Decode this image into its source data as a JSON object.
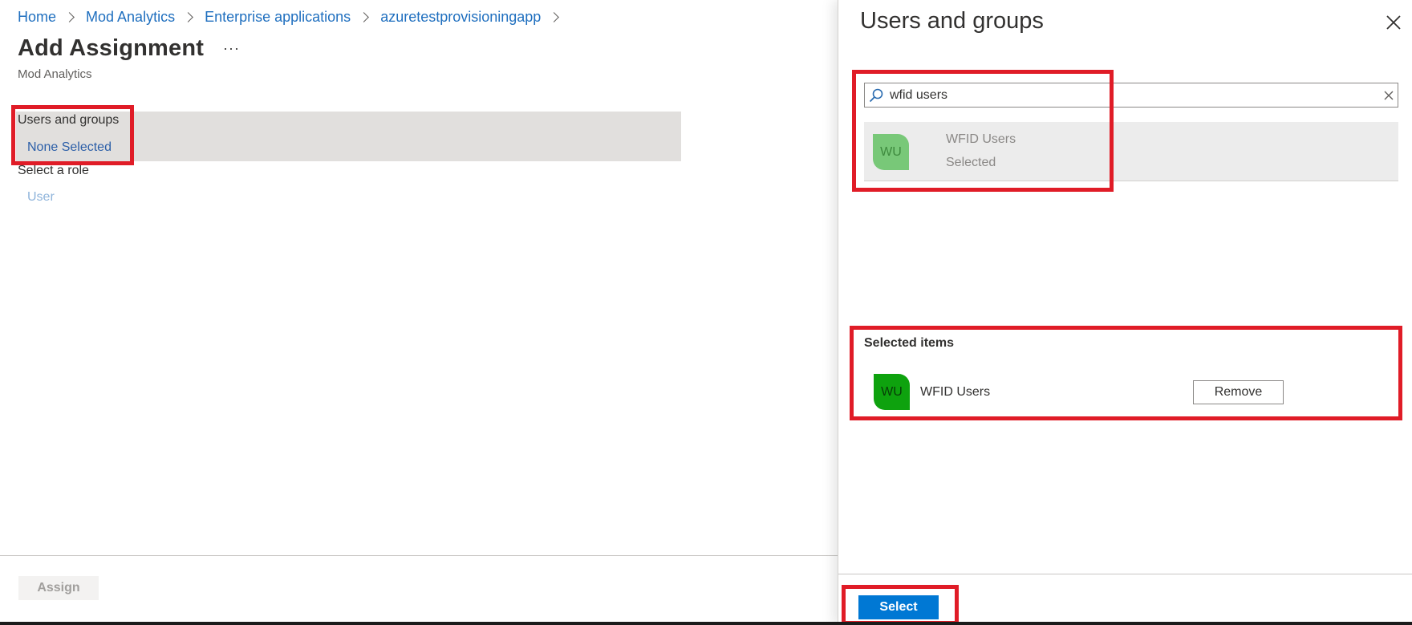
{
  "breadcrumb": [
    "Home",
    "Mod Analytics",
    "Enterprise applications",
    "azuretestprovisioningapp"
  ],
  "page": {
    "title": "Add Assignment",
    "more": "···",
    "subtitle": "Mod Analytics"
  },
  "assignment": {
    "users_label": "Users and groups",
    "users_value": "None Selected",
    "role_label": "Select a role",
    "role_value": "User"
  },
  "footer": {
    "assign_label": "Assign"
  },
  "panel": {
    "title": "Users and groups",
    "search_value": "wfid users",
    "result": {
      "initials": "WU",
      "name": "WFID Users",
      "status": "Selected"
    },
    "selected_heading": "Selected items",
    "selected": {
      "initials": "WU",
      "name": "WFID Users"
    },
    "remove_label": "Remove",
    "select_label": "Select"
  },
  "colors": {
    "link": "#1f6fbf",
    "primary_button": "#0078d4",
    "annotation": "#e01c27",
    "avatar_green": "#0ea20e"
  },
  "icons": [
    "chevron-right-icon",
    "more-icon",
    "close-icon",
    "search-icon",
    "clear-icon"
  ]
}
